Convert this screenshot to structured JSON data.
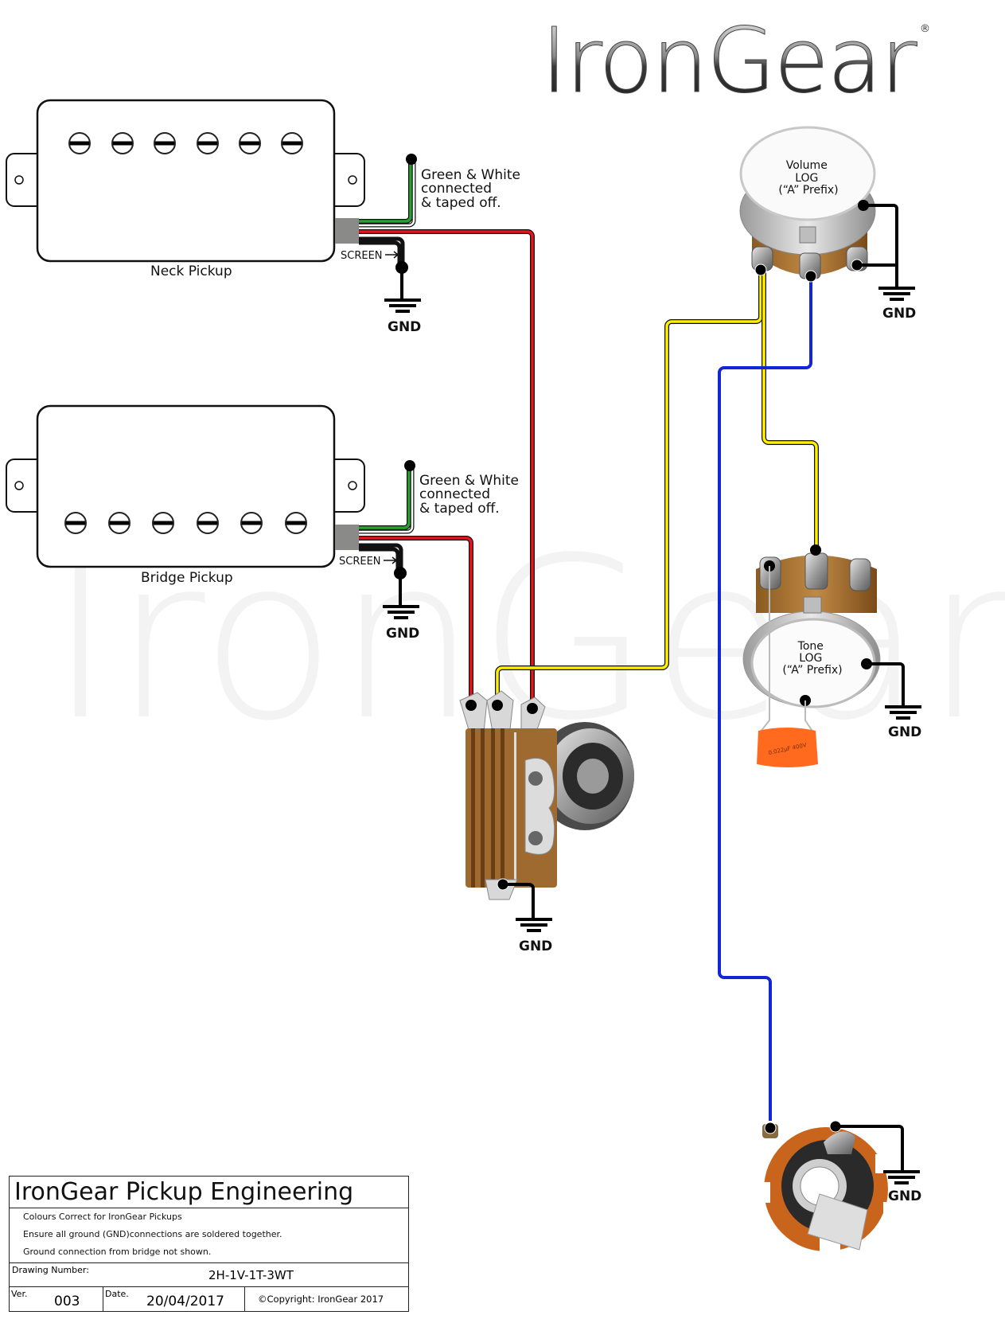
{
  "logo": {
    "text": "IronGear",
    "registered_mark": "®"
  },
  "watermark": "IronGear",
  "pickups": [
    {
      "label": "Neck Pickup",
      "pole_count": 6,
      "note": "Green & White\nconnected\n& taped off.",
      "note_lines": [
        "Green & White",
        "connected",
        "& taped off."
      ],
      "screen_label": "SCREEN",
      "gnd_label": "GND"
    },
    {
      "label": "Bridge Pickup",
      "pole_count": 6,
      "note_lines": [
        "Green & White",
        "connected",
        "& taped off."
      ],
      "screen_label": "SCREEN",
      "gnd_label": "GND"
    }
  ],
  "volume_pot": {
    "lines": [
      "Volume",
      "LOG",
      "(“A” Prefix)"
    ],
    "gnd_label": "GND"
  },
  "tone_pot": {
    "lines": [
      "Tone",
      "LOG",
      "(“A” Prefix)"
    ],
    "gnd_label": "GND",
    "capacitor_marking": "0.022µF 400V"
  },
  "switch": {
    "type": "3-way toggle",
    "gnd_label": "GND"
  },
  "jack": {
    "type": "output jack",
    "gnd_label": "GND"
  },
  "wire_colors": {
    "hot": "#e8141b",
    "green": "#2aa12e",
    "white": "#ffffff",
    "ground": "#000000",
    "yellow": "#ffef00",
    "blue": "#1326d6"
  },
  "title_block": {
    "title": "IronGear Pickup Engineering",
    "notes": [
      "Colours Correct for IronGear Pickups",
      "Ensure all ground (GND)connections are soldered together.",
      "Ground connection from bridge not shown."
    ],
    "drawing_number_label": "Drawing Number:",
    "drawing_number": "2H-1V-1T-3WT",
    "version_label": "Ver.",
    "version": "003",
    "date_label": "Date.",
    "date": "20/04/2017",
    "copyright": "©Copyright: IronGear 2017"
  }
}
